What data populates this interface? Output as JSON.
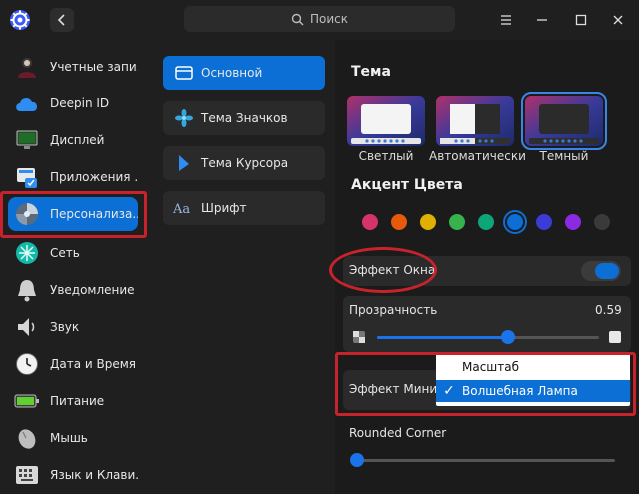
{
  "header": {
    "search_placeholder": "Поиск",
    "buttons": [
      "back",
      "menu",
      "minimize",
      "maximize",
      "close"
    ]
  },
  "sidebar": {
    "items": [
      {
        "label": "Учетные запи...",
        "icon": "user-account-icon"
      },
      {
        "label": "Deepin ID",
        "icon": "cloud-icon"
      },
      {
        "label": "Дисплей",
        "icon": "display-icon"
      },
      {
        "label": "Приложения ...",
        "icon": "default-apps-icon"
      },
      {
        "label": "Персонализа...",
        "icon": "personalization-icon",
        "active": true
      },
      {
        "label": "Сеть",
        "icon": "network-icon"
      },
      {
        "label": "Уведомление",
        "icon": "bell-icon"
      },
      {
        "label": "Звук",
        "icon": "speaker-icon"
      },
      {
        "label": "Дата и Время",
        "icon": "clock-icon"
      },
      {
        "label": "Питание",
        "icon": "battery-icon"
      },
      {
        "label": "Мышь",
        "icon": "mouse-icon"
      },
      {
        "label": "Язык и  Клави...",
        "icon": "keyboard-icon"
      }
    ]
  },
  "mid": {
    "items": [
      {
        "label": "Основной",
        "icon": "window-icon",
        "active": true
      },
      {
        "label": "Тема Значков",
        "icon": "icon-theme-icon"
      },
      {
        "label": "Тема Курсора",
        "icon": "cursor-icon"
      },
      {
        "label": "Шрифт",
        "icon": "font-icon"
      }
    ]
  },
  "content": {
    "theme_title": "Тема",
    "themes": [
      {
        "label": "Светлый"
      },
      {
        "label": "Автоматически"
      },
      {
        "label": "Темный",
        "selected": true
      }
    ],
    "accent_title": "Акцент Цвета",
    "accent_colors": [
      "#d6336c",
      "#e8590c",
      "#e0b000",
      "#37b24d",
      "#0ca678",
      "#0b6fd6",
      "#3b3bd6",
      "#8a2be2",
      "#3a3a3a"
    ],
    "accent_selected_index": 5,
    "window_effect_label": "Эффект Окна",
    "window_effect_on": true,
    "transparency_label": "Прозрачность",
    "transparency_value": "0.59",
    "transparency_fraction": 0.59,
    "minimize_effect_label": "Эффект Мини...",
    "minimize_options": [
      "Масштаб",
      "Волшебная Лампа"
    ],
    "minimize_selected_index": 1,
    "check_mark": "✓",
    "rounded_corner_label": "Rounded Corner",
    "rounded_corner_fraction": 0.0
  }
}
